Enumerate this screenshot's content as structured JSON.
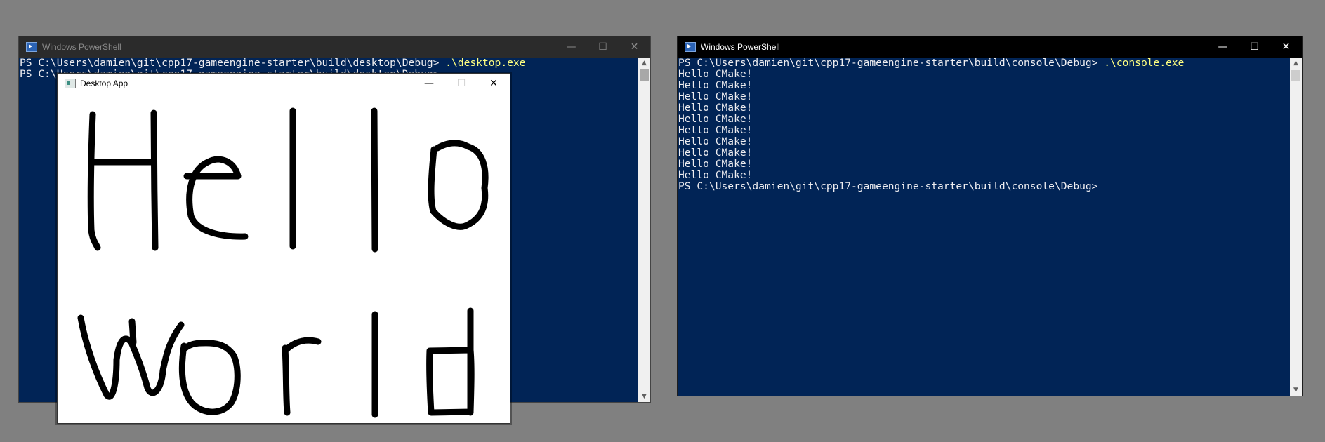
{
  "ps_left": {
    "title": "Windows PowerShell",
    "lines": [
      {
        "prompt": "PS C:\\Users\\damien\\git\\cpp17-gameengine-starter\\build\\desktop\\Debug> ",
        "cmd": ".\\desktop.exe"
      },
      {
        "prompt": "PS C:\\Users\\damien\\git\\cpp17-gameengine-starter\\build\\desktop\\Debug> ",
        "cmd": ""
      }
    ]
  },
  "ps_right": {
    "title": "Windows PowerShell",
    "lines": [
      {
        "prompt": "PS C:\\Users\\damien\\git\\cpp17-gameengine-starter\\build\\console\\Debug> ",
        "cmd": ".\\console.exe"
      },
      {
        "prompt": "Hello CMake!",
        "cmd": ""
      },
      {
        "prompt": "Hello CMake!",
        "cmd": ""
      },
      {
        "prompt": "Hello CMake!",
        "cmd": ""
      },
      {
        "prompt": "Hello CMake!",
        "cmd": ""
      },
      {
        "prompt": "Hello CMake!",
        "cmd": ""
      },
      {
        "prompt": "Hello CMake!",
        "cmd": ""
      },
      {
        "prompt": "Hello CMake!",
        "cmd": ""
      },
      {
        "prompt": "Hello CMake!",
        "cmd": ""
      },
      {
        "prompt": "Hello CMake!",
        "cmd": ""
      },
      {
        "prompt": "Hello CMake!",
        "cmd": ""
      },
      {
        "prompt": "PS C:\\Users\\damien\\git\\cpp17-gameengine-starter\\build\\console\\Debug>",
        "cmd": ""
      }
    ]
  },
  "desktop_app": {
    "title": "Desktop App",
    "drawing_text": [
      "Hello",
      "World"
    ]
  },
  "window_controls": {
    "minimize": "—",
    "maximize": "☐",
    "close": "✕"
  },
  "colors": {
    "console_bg": "#012456",
    "console_fg": "#eeedf0",
    "command": "#ffff80",
    "desktop_bg": "#808080"
  },
  "icons": {
    "powershell": "powershell-icon",
    "app": "app-icon"
  }
}
